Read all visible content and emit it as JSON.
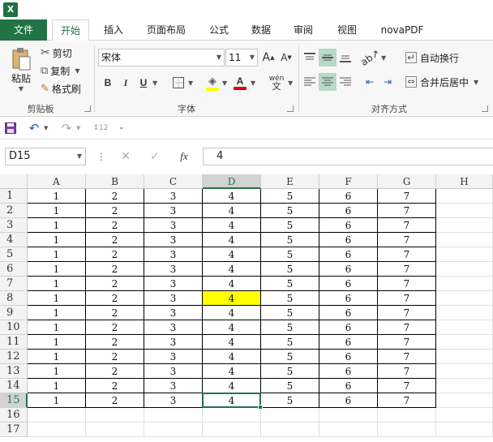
{
  "app": {
    "logo": "X"
  },
  "tabs": [
    {
      "label": "文件",
      "kind": "file"
    },
    {
      "label": "开始",
      "kind": "active"
    },
    {
      "label": "插入",
      "kind": ""
    },
    {
      "label": "页面布局",
      "kind": ""
    },
    {
      "label": "公式",
      "kind": ""
    },
    {
      "label": "数据",
      "kind": ""
    },
    {
      "label": "审阅",
      "kind": ""
    },
    {
      "label": "视图",
      "kind": ""
    },
    {
      "label": "novaPDF",
      "kind": ""
    }
  ],
  "ribbon": {
    "clipboard": {
      "paste_label": "粘贴",
      "cut_label": "剪切",
      "copy_label": "复制",
      "format_painter_label": "格式刷",
      "group_label": "剪贴板"
    },
    "font": {
      "font_name": "宋体",
      "font_size": "11",
      "grow_font": "A",
      "shrink_font": "A",
      "bold": "B",
      "italic": "I",
      "underline": "U",
      "phonetic": "wén",
      "font_color_glyph": "A",
      "group_label": "字体"
    },
    "alignment": {
      "wrap_text_label": "自动换行",
      "merge_center_label": "合并后居中",
      "group_label": "对齐方式"
    }
  },
  "formula_bar": {
    "name_box": "D15",
    "fx": "fx",
    "content": "4"
  },
  "grid": {
    "columns": [
      "A",
      "B",
      "C",
      "D",
      "E",
      "F",
      "G",
      "H"
    ],
    "selected_column": "D",
    "selected_row": "15",
    "row_numbers": [
      "1",
      "2",
      "3",
      "4",
      "5",
      "6",
      "7",
      "8",
      "9",
      "10",
      "11",
      "12",
      "13",
      "14",
      "15",
      "16",
      "17"
    ],
    "data_row_values": [
      "1",
      "2",
      "3",
      "4",
      "5",
      "6",
      "7"
    ],
    "highlight_cell": "D8",
    "highlight_color": "#ffff00",
    "selection_color": "#217346"
  },
  "colors": {
    "accent": "#217346"
  }
}
